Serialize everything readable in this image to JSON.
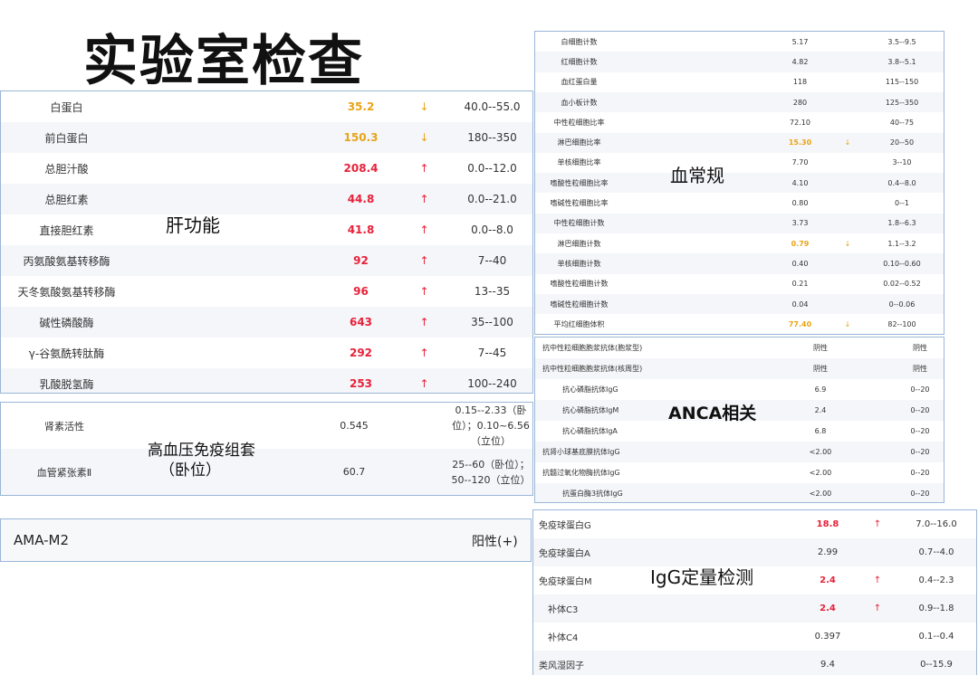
{
  "page": {
    "title": "实验室检查"
  },
  "liver": {
    "label": "肝功能",
    "rows": [
      {
        "name": "白蛋白",
        "value": "35.2",
        "arrow": "↓",
        "ref": "40.0--55.0",
        "flag": "low"
      },
      {
        "name": "前白蛋白",
        "value": "150.3",
        "arrow": "↓",
        "ref": "180--350",
        "flag": "low"
      },
      {
        "name": "总胆汁酸",
        "value": "208.4",
        "arrow": "↑",
        "ref": "0.0--12.0",
        "flag": "high"
      },
      {
        "name": "总胆红素",
        "value": "44.8",
        "arrow": "↑",
        "ref": "0.0--21.0",
        "flag": "high"
      },
      {
        "name": "直接胆红素",
        "value": "41.8",
        "arrow": "↑",
        "ref": "0.0--8.0",
        "flag": "high"
      },
      {
        "name": "丙氨酸氨基转移酶",
        "value": "92",
        "arrow": "↑",
        "ref": "7--40",
        "flag": "high"
      },
      {
        "name": "天冬氨酸氨基转移酶",
        "value": "96",
        "arrow": "↑",
        "ref": "13--35",
        "flag": "high"
      },
      {
        "name": "碱性磷酸酶",
        "value": "643",
        "arrow": "↑",
        "ref": "35--100",
        "flag": "high"
      },
      {
        "name": "γ-谷氨酰转肽酶",
        "value": "292",
        "arrow": "↑",
        "ref": "7--45",
        "flag": "high"
      },
      {
        "name": "乳酸脱氢酶",
        "value": "253",
        "arrow": "↑",
        "ref": "100--240",
        "flag": "high"
      }
    ]
  },
  "hypertension": {
    "label_line1": "高血压免疫组套",
    "label_line2": "（卧位）",
    "rows": [
      {
        "name": "肾素活性",
        "value": "0.545",
        "ref": "0.15--2.33（卧位）；0.10~6.56（立位）"
      },
      {
        "name": "血管紧张素Ⅱ",
        "value": "60.7",
        "ref": "25--60（卧位）；50--120（立位）"
      }
    ]
  },
  "ama": {
    "name": "AMA-M2",
    "value": "阳性(+)"
  },
  "blood": {
    "label": "血常规",
    "rows": [
      {
        "name": "白细胞计数",
        "value": "5.17",
        "arrow": "",
        "ref": "3.5--9.5",
        "flag": ""
      },
      {
        "name": "红细胞计数",
        "value": "4.82",
        "arrow": "",
        "ref": "3.8--5.1",
        "flag": ""
      },
      {
        "name": "血红蛋白量",
        "value": "118",
        "arrow": "",
        "ref": "115--150",
        "flag": ""
      },
      {
        "name": "血小板计数",
        "value": "280",
        "arrow": "",
        "ref": "125--350",
        "flag": ""
      },
      {
        "name": "中性粒细胞比率",
        "value": "72.10",
        "arrow": "",
        "ref": "40--75",
        "flag": ""
      },
      {
        "name": "淋巴细胞比率",
        "value": "15.30",
        "arrow": "↓",
        "ref": "20--50",
        "flag": "low"
      },
      {
        "name": "单核细胞比率",
        "value": "7.70",
        "arrow": "",
        "ref": "3--10",
        "flag": ""
      },
      {
        "name": "嗜酸性粒细胞比率",
        "value": "4.10",
        "arrow": "",
        "ref": "0.4--8.0",
        "flag": ""
      },
      {
        "name": "嗜碱性粒细胞比率",
        "value": "0.80",
        "arrow": "",
        "ref": "0--1",
        "flag": ""
      },
      {
        "name": "中性粒细胞计数",
        "value": "3.73",
        "arrow": "",
        "ref": "1.8--6.3",
        "flag": ""
      },
      {
        "name": "淋巴细胞计数",
        "value": "0.79",
        "arrow": "↓",
        "ref": "1.1--3.2",
        "flag": "low"
      },
      {
        "name": "单核细胞计数",
        "value": "0.40",
        "arrow": "",
        "ref": "0.10--0.60",
        "flag": ""
      },
      {
        "name": "嗜酸性粒细胞计数",
        "value": "0.21",
        "arrow": "",
        "ref": "0.02--0.52",
        "flag": ""
      },
      {
        "name": "嗜碱性粒细胞计数",
        "value": "0.04",
        "arrow": "",
        "ref": "0--0.06",
        "flag": ""
      },
      {
        "name": "平均红细胞体积",
        "value": "77.40",
        "arrow": "↓",
        "ref": "82--100",
        "flag": "low"
      }
    ]
  },
  "anca": {
    "label": "ANCA相关",
    "rows": [
      {
        "name": "抗中性粒细胞胞浆抗体(胞浆型)",
        "value": "阴性",
        "ref": "阴性",
        "indent": false
      },
      {
        "name": "抗中性粒细胞胞浆抗体(核周型)",
        "value": "阴性",
        "ref": "阴性",
        "indent": false
      },
      {
        "name": "抗心磷脂抗体IgG",
        "value": "6.9",
        "ref": "0--20",
        "indent": true
      },
      {
        "name": "抗心磷脂抗体IgM",
        "value": "2.4",
        "ref": "0--20",
        "indent": true
      },
      {
        "name": "抗心磷脂抗体IgA",
        "value": "6.8",
        "ref": "0--20",
        "indent": true
      },
      {
        "name": "抗肾小球基底膜抗体IgG",
        "value": "<2.00",
        "ref": "0--20",
        "indent": false
      },
      {
        "name": "抗髓过氧化物酶抗体IgG",
        "value": "<2.00",
        "ref": "0--20",
        "indent": false
      },
      {
        "name": "抗蛋白酶3抗体IgG",
        "value": "<2.00",
        "ref": "0--20",
        "indent": true
      }
    ]
  },
  "igg": {
    "label": "IgG定量检测",
    "rows": [
      {
        "name": "免疫球蛋白G",
        "value": "18.8",
        "arrow": "↑",
        "ref": "7.0--16.0",
        "flag": "high",
        "indent": false
      },
      {
        "name": "免疫球蛋白A",
        "value": "2.99",
        "arrow": "",
        "ref": "0.7--4.0",
        "flag": "",
        "indent": false
      },
      {
        "name": "免疫球蛋白M",
        "value": "2.4",
        "arrow": "↑",
        "ref": "0.4--2.3",
        "flag": "high",
        "indent": false
      },
      {
        "name": "补体C3",
        "value": "2.4",
        "arrow": "↑",
        "ref": "0.9--1.8",
        "flag": "high",
        "indent": true
      },
      {
        "name": "补体C4",
        "value": "0.397",
        "arrow": "",
        "ref": "0.1--0.4",
        "flag": "",
        "indent": true
      },
      {
        "name": "类风湿因子",
        "value": "9.4",
        "arrow": "",
        "ref": "0--15.9",
        "flag": "",
        "indent": false
      }
    ]
  },
  "colors": {
    "high": "#e8213a",
    "low": "#e8a417",
    "border": "#9ab6d8",
    "stripe": "#f4f6f9"
  }
}
